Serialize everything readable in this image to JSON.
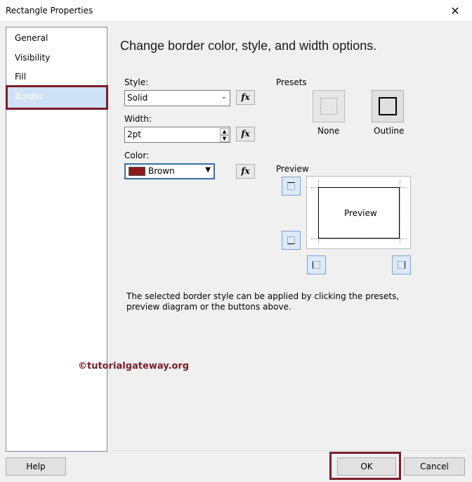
{
  "window": {
    "title": "Rectangle Properties",
    "close_glyph": "✕"
  },
  "sidebar": {
    "items": [
      {
        "label": "General"
      },
      {
        "label": "Visibility"
      },
      {
        "label": "Fill"
      },
      {
        "label": "Border",
        "selected": true
      }
    ]
  },
  "main": {
    "heading": "Change border color, style, and width options.",
    "style": {
      "label": "Style:",
      "value": "Solid"
    },
    "width": {
      "label": "Width:",
      "value": "2pt"
    },
    "color": {
      "label": "Color:",
      "value": "Brown",
      "swatch": "#8b1a1a"
    },
    "fx_icon": "fx",
    "presets": {
      "label": "Presets",
      "items": [
        {
          "label": "None"
        },
        {
          "label": "Outline"
        }
      ]
    },
    "preview": {
      "label": "Preview",
      "box_text": "Preview"
    },
    "hint": "The selected border style can be applied by clicking the presets, preview diagram or the buttons above."
  },
  "watermark": "©tutorialgateway.org",
  "footer": {
    "help": "Help",
    "ok": "OK",
    "cancel": "Cancel"
  },
  "colors": {
    "highlight": "#7a1e2a",
    "selection": "#cfe2f5"
  }
}
